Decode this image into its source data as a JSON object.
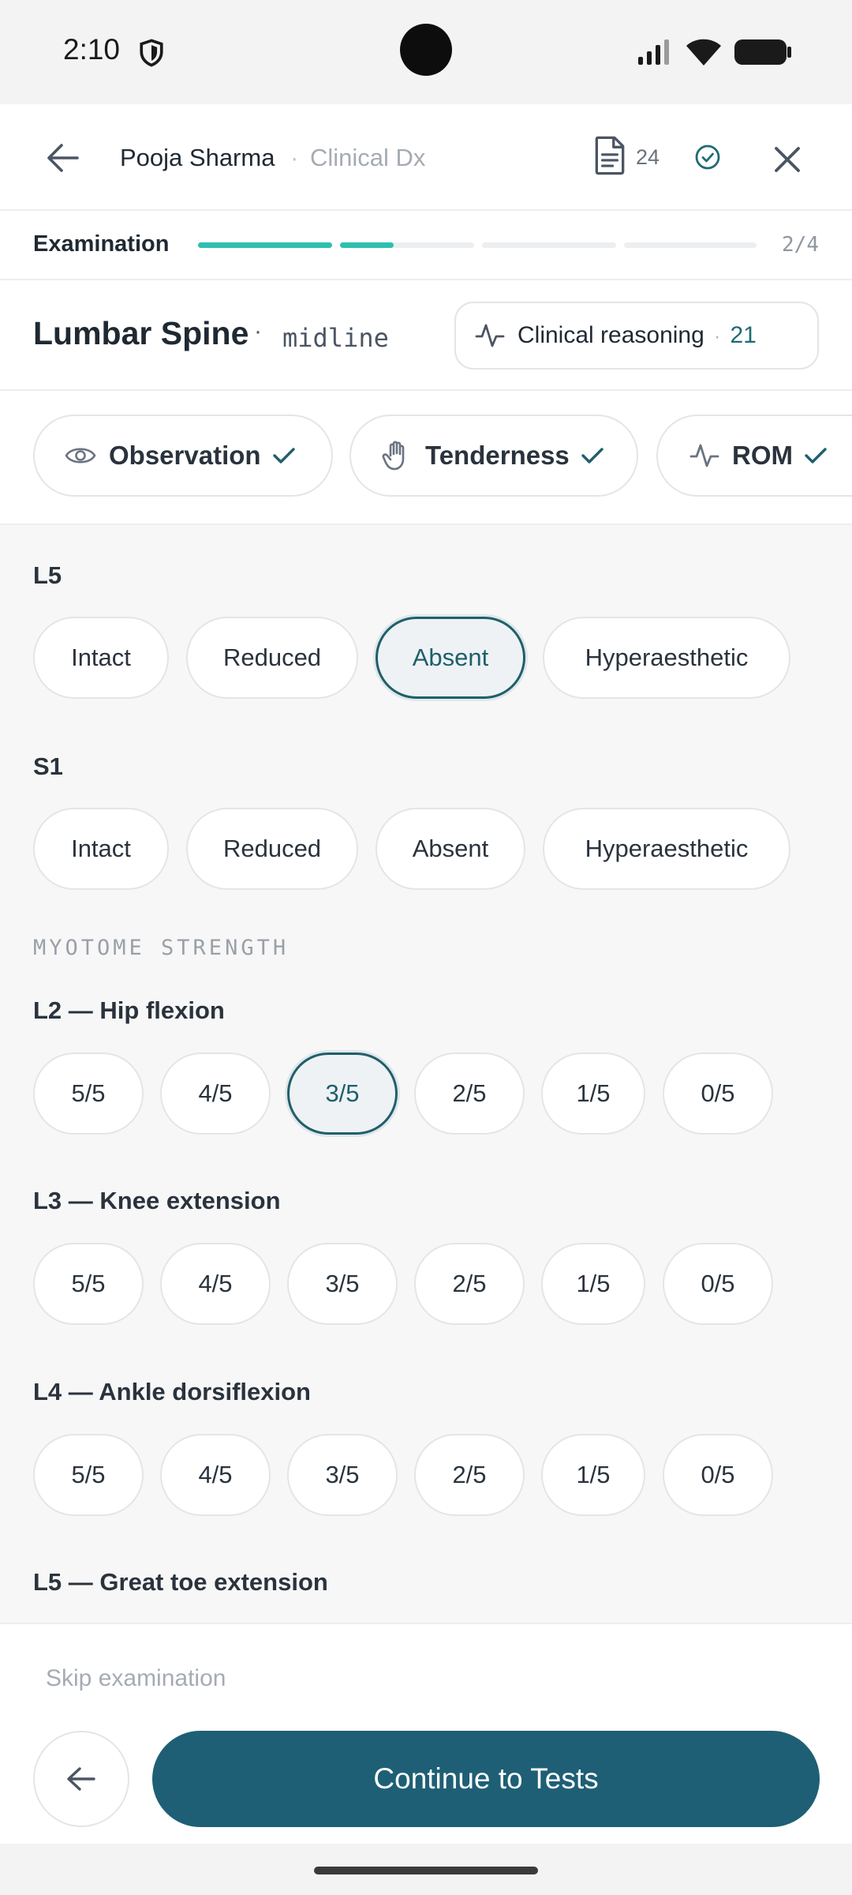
{
  "status": {
    "time": "2:10"
  },
  "header": {
    "patient": "Pooja Sharma",
    "separator": "·",
    "context": "Clinical Dx",
    "doc_count": "24"
  },
  "progress": {
    "label": "Examination",
    "step": "2/4",
    "segments": [
      1.0,
      0.4,
      0,
      0,
      0
    ]
  },
  "region": {
    "title": "Lumbar Spine",
    "separator": "·",
    "subtitle": "midline",
    "reasoning": {
      "label": "Clinical reasoning",
      "separator": "·",
      "count": "21"
    }
  },
  "tabs": [
    {
      "label": "Observation",
      "icon": "eye-icon"
    },
    {
      "label": "Tenderness",
      "icon": "hand-icon"
    },
    {
      "label": "ROM",
      "icon": "activity-icon"
    }
  ],
  "dermatomes": [
    {
      "label": "L5",
      "options": [
        "Intact",
        "Reduced",
        "Absent",
        "Hyperaesthetic"
      ],
      "selected": "Absent"
    },
    {
      "label": "S1",
      "options": [
        "Intact",
        "Reduced",
        "Absent",
        "Hyperaesthetic"
      ],
      "selected": null
    }
  ],
  "myotome": {
    "caption": "MYOTOME STRENGTH",
    "groups": [
      {
        "label": "L2 — Hip flexion",
        "options": [
          "5/5",
          "4/5",
          "3/5",
          "2/5",
          "1/5",
          "0/5"
        ],
        "selected": "3/5"
      },
      {
        "label": "L3 — Knee extension",
        "options": [
          "5/5",
          "4/5",
          "3/5",
          "2/5",
          "1/5",
          "0/5"
        ],
        "selected": null
      },
      {
        "label": "L4 — Ankle dorsiflexion",
        "options": [
          "5/5",
          "4/5",
          "3/5",
          "2/5",
          "1/5",
          "0/5"
        ],
        "selected": null
      },
      {
        "label": "L5 — Great toe extension",
        "options": [],
        "selected": null
      }
    ]
  },
  "footer": {
    "skip": "Skip examination",
    "continue": "Continue to Tests"
  },
  "colors": {
    "accent": "#1e5f75",
    "progress": "#2dbfb0",
    "selected_border": "#1f5f6a"
  }
}
